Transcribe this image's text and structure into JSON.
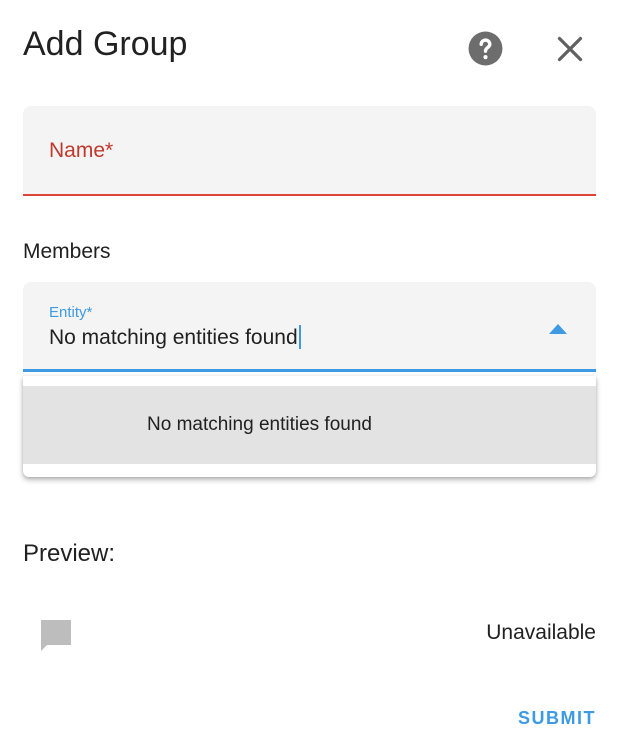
{
  "dialog": {
    "title": "Add Group",
    "help_icon": "help-circle-icon",
    "close_icon": "close-icon"
  },
  "name_field": {
    "label": "Name*",
    "value": ""
  },
  "members": {
    "section_label": "Members",
    "entity_field": {
      "label": "Entity*",
      "value": "No matching entities found",
      "dropdown_icon": "menu-up-icon"
    },
    "dropdown": {
      "items": [
        "No matching entities found"
      ]
    }
  },
  "preview": {
    "label": "Preview:",
    "icon": "comment-icon",
    "state": "Unavailable"
  },
  "actions": {
    "submit_label": "SUBMIT"
  },
  "colors": {
    "accent": "#3d9ae3",
    "error": "#db4437",
    "field_bg": "#f4f4f4",
    "item_bg": "#e3e3e3"
  }
}
